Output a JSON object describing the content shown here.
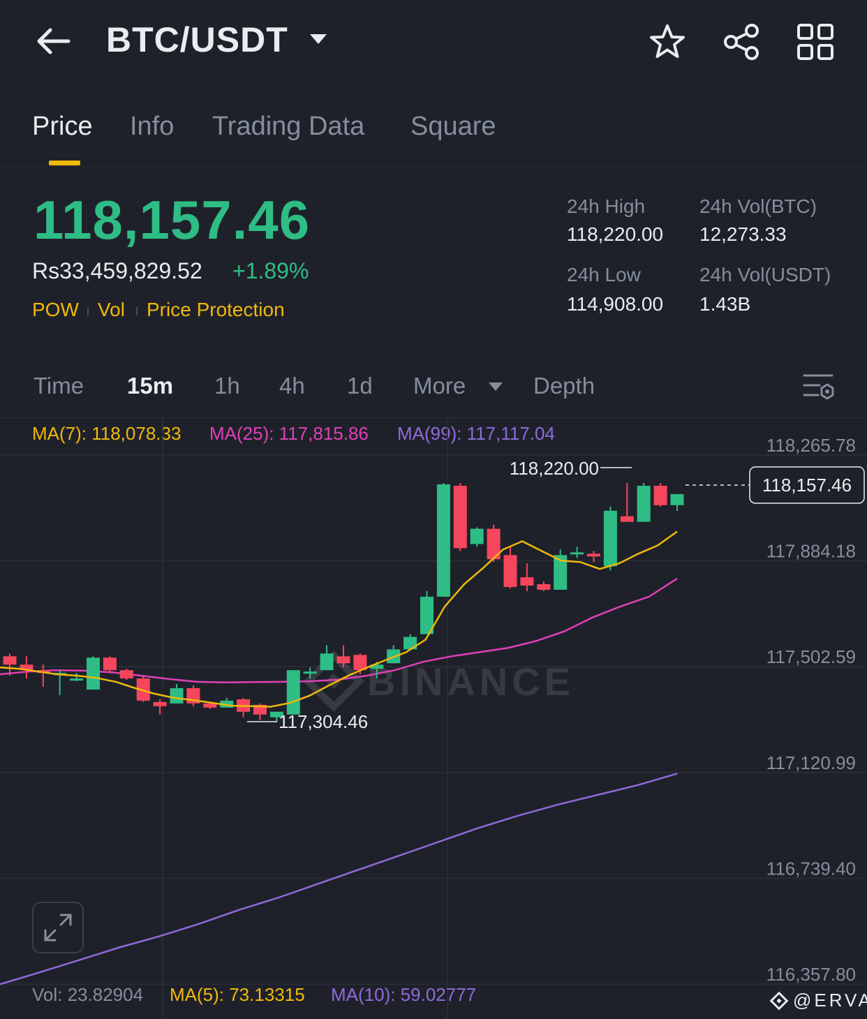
{
  "header": {
    "title": "BTC/USDT",
    "icons": [
      "back-arrow-icon",
      "caret-down-icon",
      "star-icon",
      "share-icon",
      "grid-icon"
    ]
  },
  "tabs": [
    {
      "label": "Price",
      "active": true
    },
    {
      "label": "Info",
      "active": false
    },
    {
      "label": "Trading Data",
      "active": false
    },
    {
      "label": "Square",
      "active": false
    }
  ],
  "ticker": {
    "last_price": "118,157.46",
    "fiat_price": "Rs33,459,829.52",
    "change_pct": "+1.89%",
    "tags": [
      "POW",
      "Vol",
      "Price Protection"
    ],
    "stats": {
      "high_label": "24h High",
      "high_value": "118,220.00",
      "low_label": "24h Low",
      "low_value": "114,908.00",
      "vol_btc_label": "24h Vol(BTC)",
      "vol_btc_value": "12,273.33",
      "vol_usdt_label": "24h Vol(USDT)",
      "vol_usdt_value": "1.43B"
    }
  },
  "intervals": {
    "items": [
      "Time",
      "15m",
      "1h",
      "4h",
      "1d",
      "More"
    ],
    "active": "15m",
    "depth_label": "Depth"
  },
  "ma_legend": {
    "ma7": "MA(7): 118,078.33",
    "ma25": "MA(25): 117,815.86",
    "ma99": "MA(99): 117,117.04"
  },
  "volume_legend": {
    "vol": "Vol: 23.82904",
    "ma5": "MA(5): 73.13315",
    "ma10": "MA(10): 59.02777"
  },
  "watermark": "@ERVA",
  "colors": {
    "up": "#2ebd85",
    "down": "#f6465d",
    "ma7": "#f0b90b",
    "ma25": "#e040b8",
    "ma99": "#8f6bd9",
    "background": "#1f212a",
    "accent": "#f0b90b"
  },
  "chart_data": {
    "type": "candlestick",
    "interval": "15m",
    "y_ticks": [
      "118,265.78",
      "117,884.18",
      "117,502.59",
      "117,120.99",
      "116,739.40",
      "116,357.80"
    ],
    "ylim": [
      116357.8,
      118265.78
    ],
    "high_marker": "118,220.00",
    "low_marker": "117,304.46",
    "current_price_label": "118,157.46",
    "current_price": 118157.46,
    "candles": [
      {
        "o": 117540,
        "h": 117550,
        "l": 117470,
        "c": 117510
      },
      {
        "o": 117510,
        "h": 117540,
        "l": 117460,
        "c": 117490
      },
      {
        "o": 117490,
        "h": 117510,
        "l": 117430,
        "c": 117480
      },
      {
        "o": 117480,
        "h": 117490,
        "l": 117400,
        "c": 117480
      },
      {
        "o": 117460,
        "h": 117480,
        "l": 117450,
        "c": 117460
      },
      {
        "o": 117420,
        "h": 117540,
        "l": 117420,
        "c": 117535
      },
      {
        "o": 117535,
        "h": 117540,
        "l": 117480,
        "c": 117490
      },
      {
        "o": 117490,
        "h": 117495,
        "l": 117455,
        "c": 117460
      },
      {
        "o": 117460,
        "h": 117470,
        "l": 117375,
        "c": 117380
      },
      {
        "o": 117375,
        "h": 117385,
        "l": 117330,
        "c": 117360
      },
      {
        "o": 117370,
        "h": 117440,
        "l": 117370,
        "c": 117425
      },
      {
        "o": 117425,
        "h": 117435,
        "l": 117360,
        "c": 117370
      },
      {
        "o": 117370,
        "h": 117375,
        "l": 117350,
        "c": 117355
      },
      {
        "o": 117355,
        "h": 117390,
        "l": 117355,
        "c": 117380
      },
      {
        "o": 117385,
        "h": 117390,
        "l": 117320,
        "c": 117340
      },
      {
        "o": 117365,
        "h": 117370,
        "l": 117310,
        "c": 117330
      },
      {
        "o": 117320,
        "h": 117340,
        "l": 117304.46,
        "c": 117340
      },
      {
        "o": 117330,
        "h": 117490,
        "l": 117330,
        "c": 117490
      },
      {
        "o": 117480,
        "h": 117500,
        "l": 117460,
        "c": 117485
      },
      {
        "o": 117490,
        "h": 117580,
        "l": 117490,
        "c": 117550
      },
      {
        "o": 117540,
        "h": 117580,
        "l": 117500,
        "c": 117515
      },
      {
        "o": 117545,
        "h": 117550,
        "l": 117475,
        "c": 117490
      },
      {
        "o": 117495,
        "h": 117520,
        "l": 117460,
        "c": 117510
      },
      {
        "o": 117515,
        "h": 117580,
        "l": 117515,
        "c": 117565
      },
      {
        "o": 117565,
        "h": 117620,
        "l": 117565,
        "c": 117610
      },
      {
        "o": 117620,
        "h": 117775,
        "l": 117620,
        "c": 117755
      },
      {
        "o": 117755,
        "h": 118165,
        "l": 117755,
        "c": 118160
      },
      {
        "o": 118155,
        "h": 118165,
        "l": 117920,
        "c": 117930
      },
      {
        "o": 117945,
        "h": 118005,
        "l": 117935,
        "c": 118000
      },
      {
        "o": 118000,
        "h": 118015,
        "l": 117880,
        "c": 117890
      },
      {
        "o": 117905,
        "h": 117935,
        "l": 117785,
        "c": 117790
      },
      {
        "o": 117825,
        "h": 117875,
        "l": 117775,
        "c": 117795
      },
      {
        "o": 117800,
        "h": 117810,
        "l": 117775,
        "c": 117780
      },
      {
        "o": 117780,
        "h": 117925,
        "l": 117780,
        "c": 117905
      },
      {
        "o": 117915,
        "h": 117935,
        "l": 117895,
        "c": 117915
      },
      {
        "o": 117910,
        "h": 117920,
        "l": 117880,
        "c": 117900
      },
      {
        "o": 117865,
        "h": 118080,
        "l": 117850,
        "c": 118065
      },
      {
        "o": 118045,
        "h": 118165,
        "l": 118025,
        "c": 118025
      },
      {
        "o": 118025,
        "h": 118165,
        "l": 118025,
        "c": 118155
      },
      {
        "o": 118155,
        "h": 118165,
        "l": 118080,
        "c": 118085
      },
      {
        "o": 118085,
        "h": 118125,
        "l": 118065,
        "c": 118125
      }
    ],
    "ma7_line": [
      117500,
      117495,
      117485,
      117475,
      117470,
      117462,
      117448,
      117425,
      117405,
      117390,
      117382,
      117372,
      117362,
      117360,
      117358,
      117372,
      117398,
      117435,
      117470,
      117500,
      117528,
      117555,
      117600,
      117720,
      117800,
      117860,
      117925,
      117955,
      117920,
      117885,
      117880,
      117855,
      117875,
      117910,
      117940,
      117990
    ],
    "ma25_line": [
      117475,
      117485,
      117490,
      117488,
      117482,
      117470,
      117458,
      117448,
      117446,
      117447,
      117448,
      117450,
      117456,
      117470,
      117490,
      117520,
      117540,
      117555,
      117570,
      117595,
      117630,
      117680,
      117720,
      117755,
      117820
    ],
    "ma99_line": [
      116357,
      116400,
      116445,
      116490,
      116530,
      116575,
      116625,
      116670,
      116720,
      116770,
      116820,
      116870,
      116920,
      116965,
      117005,
      117040,
      117075,
      117117.04
    ]
  }
}
